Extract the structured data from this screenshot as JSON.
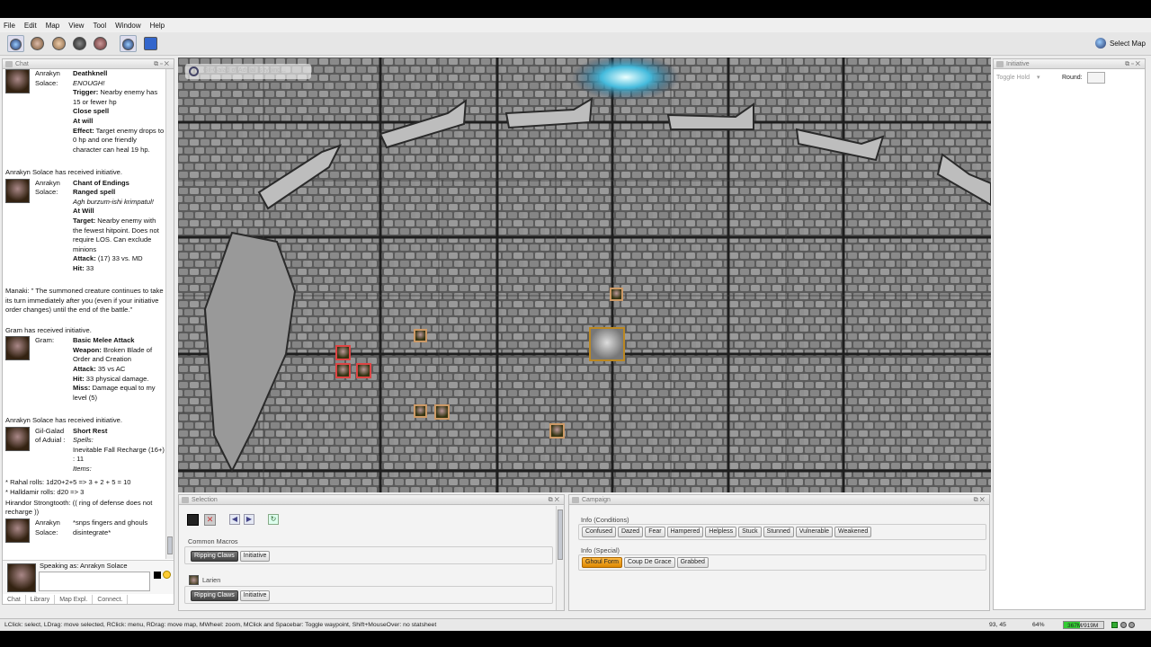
{
  "menu": [
    "File",
    "Edit",
    "Map",
    "View",
    "Tool",
    "Window",
    "Help"
  ],
  "toolbar": {
    "select_map_label": "Select Map",
    "select_map_icon": "globe-icon"
  },
  "chat": {
    "title": "Chat",
    "messages": [
      {
        "who": "Anrakyn Solace:",
        "lines": [
          [
            "b",
            "Deathknell"
          ],
          [
            "i",
            "ENOUGH!"
          ],
          [
            "bmix",
            "Trigger:",
            " Nearby enemy has 15 or fewer hp"
          ],
          [
            "b",
            "Close spell"
          ],
          [
            "b",
            "At will"
          ],
          [
            "bmix",
            "Effect:",
            " Target enemy drops to 0 hp and one friendly character can heal 19 hp."
          ]
        ]
      },
      {
        "plain": "Anrakyn Solace has received initiative."
      },
      {
        "who": "Anrakyn Solace:",
        "lines": [
          [
            "b",
            "Chant of Endings"
          ],
          [
            "b",
            "Ranged spell"
          ],
          [
            "i",
            "Agh burzum-ishi krimpatul!"
          ],
          [
            "b",
            "At Will"
          ],
          [
            "bmix",
            "Target:",
            " Nearby enemy with the fewest hitpoint. Does not require LOS. Can exclude minions"
          ],
          [
            "bmix",
            "Attack:",
            " (17) 33 vs. MD"
          ],
          [
            "bmix",
            "Hit:",
            " 33"
          ]
        ]
      },
      {
        "plain": "Manaki:  \" The summoned creature continues to take its turn immediately after you (even if your initiative order changes) until the end of the battle.\""
      },
      {
        "plain": "Gram has received initiative."
      },
      {
        "who": "Gram:",
        "lines": [
          [
            "b",
            "Basic Melee Attack"
          ],
          [
            "bmix",
            "Weapon:",
            " Broken Blade of Order and Creation"
          ],
          [
            "bmix",
            "Attack:",
            " 35 vs AC"
          ],
          [
            "bmix",
            "Hit:",
            " 33 physical damage."
          ],
          [
            "bmix",
            "Miss:",
            " Damage equal to my level (5)"
          ]
        ]
      },
      {
        "plain": "Anrakyn Solace has received initiative."
      },
      {
        "who": "Gil-Galad of Aduial :",
        "lines": [
          [
            "b",
            "Short Rest"
          ],
          [
            "i",
            "Spells:"
          ],
          [
            "n",
            "Inevitable Fall Recharge (16+) : 11"
          ],
          [
            "i",
            "Items:"
          ]
        ]
      },
      {
        "plain": "* Rahal rolls: 1d20+2+5 => 3 + 2 + 5 = 10"
      },
      {
        "plain": "* Halldamir rolls: d20 => 3"
      },
      {
        "plain": "Hirandor Strongtooth: (( ring of defense does not recharge ))"
      },
      {
        "who": "Anrakyn Solace:",
        "lines": [
          [
            "n",
            "*snps fingers and ghouls disintegrate*"
          ]
        ]
      }
    ],
    "speaking_as": "Speaking as: Anrakyn Solace",
    "tabs": [
      "Chat",
      "Library",
      "Map Expl.",
      "Connect."
    ]
  },
  "map": {
    "typing_indicator": "Gil-Galad of Aduial is typing..."
  },
  "initiative": {
    "title": "Initiative",
    "toggle_hold": "Toggle Hold",
    "round_label": "Round:",
    "round_value": ""
  },
  "selection": {
    "title": "Selection",
    "common_macros_label": "Common Macros",
    "common_macros": [
      "Ripping Claws",
      "Initiative"
    ],
    "token_name": "Larien",
    "token_macros": [
      "Ripping Claws",
      "Initiative"
    ]
  },
  "campaign": {
    "title": "Campaign",
    "conditions_label": "Info (Conditions)",
    "conditions": [
      "Confused",
      "Dazed",
      "Fear",
      "Hampered",
      "Helpless",
      "Stuck",
      "Stunned",
      "Vulnerable",
      "Weakened"
    ],
    "special_label": "Info (Special)",
    "special": [
      "Ghoul Form",
      "Coup De Grace",
      "Grabbed"
    ]
  },
  "status": {
    "hint": "LClick: select, LDrag: move selected, RClick: menu, RDrag: move map, MWheel: zoom, MClick and Spacebar: Toggle waypoint, Shift+MouseOver: no statsheet",
    "coords": "93, 45",
    "zoom": "64%",
    "memory": "367M/919M",
    "memory_fraction": 0.4
  },
  "colors": {
    "accent": "#3c3",
    "highlight": "#f0a020",
    "dark_button": "#555555"
  }
}
